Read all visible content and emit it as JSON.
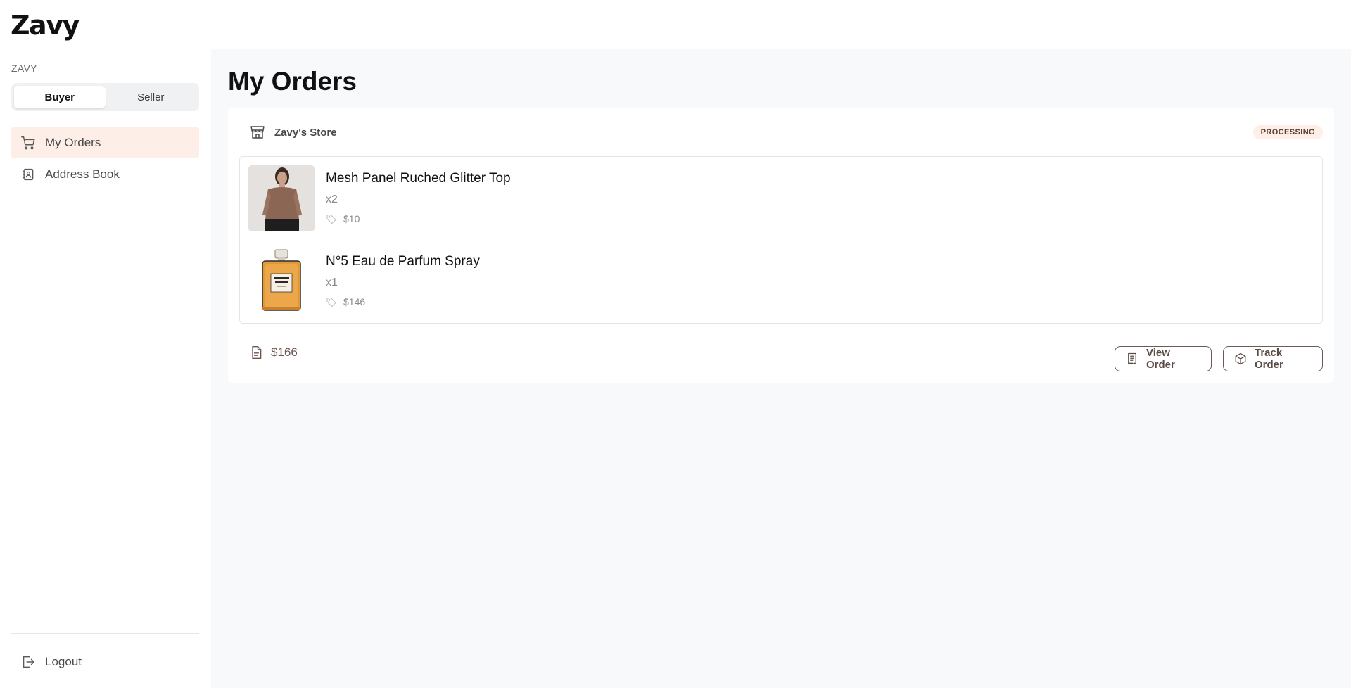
{
  "app": {
    "logo": "Zavy"
  },
  "sidebar": {
    "section_label": "ZAVY",
    "roles": [
      {
        "label": "Buyer",
        "active": true
      },
      {
        "label": "Seller",
        "active": false
      }
    ],
    "items": [
      {
        "label": "My Orders",
        "icon": "cart-icon",
        "active": true
      },
      {
        "label": "Address Book",
        "icon": "address-book-icon",
        "active": false
      }
    ],
    "logout_label": "Logout"
  },
  "main": {
    "title": "My Orders",
    "orders": [
      {
        "store": "Zavy's Store",
        "status": "PROCESSING",
        "items": [
          {
            "name": "Mesh Panel Ruched Glitter Top",
            "qty": "x2",
            "price": "$10",
            "image": "product-photo-top"
          },
          {
            "name": "N°5 Eau de Parfum Spray",
            "qty": "x1",
            "price": "$146",
            "image": "product-photo-perfume"
          }
        ],
        "total": "$166",
        "actions": {
          "view": "View Order",
          "track": "Track Order"
        }
      }
    ]
  },
  "colors": {
    "accent_bg": "#fdeee8",
    "page_bg": "#f8f9fa",
    "button_border": "#6b5a55"
  }
}
